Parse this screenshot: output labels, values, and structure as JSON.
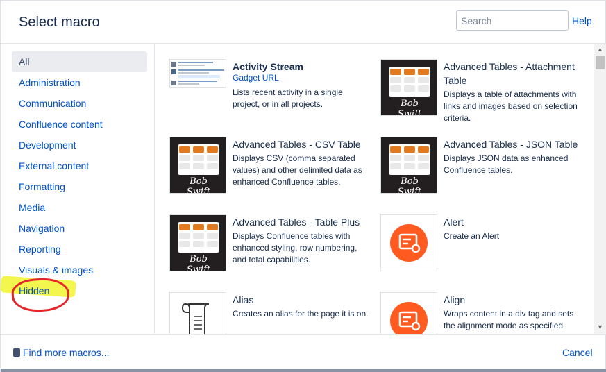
{
  "header": {
    "title": "Select macro",
    "search_placeholder": "Search",
    "help_label": "Help"
  },
  "sidebar": {
    "categories": [
      {
        "label": "All",
        "active": true
      },
      {
        "label": "Administration"
      },
      {
        "label": "Communication"
      },
      {
        "label": "Confluence content"
      },
      {
        "label": "Development"
      },
      {
        "label": "External content"
      },
      {
        "label": "Formatting"
      },
      {
        "label": "Media"
      },
      {
        "label": "Navigation"
      },
      {
        "label": "Reporting"
      },
      {
        "label": "Visuals & images"
      },
      {
        "label": "Hidden"
      }
    ]
  },
  "macros": [
    {
      "name": "Activity Stream",
      "link": "Gadget URL",
      "description": "Lists recent activity in a single project, or in all projects.",
      "thumb": "activity-stream"
    },
    {
      "name": "Advanced Tables - Attachment Table",
      "description": "Displays a table of attachments with links and images based on selection criteria.",
      "thumb": "bob-swift"
    },
    {
      "name": "Advanced Tables - CSV Table",
      "description": "Displays CSV (comma separated values) and other delimited data as enhanced Confluence tables.",
      "thumb": "bob-swift"
    },
    {
      "name": "Advanced Tables - JSON Table",
      "description": "Displays JSON data as enhanced Confluence tables.",
      "thumb": "bob-swift"
    },
    {
      "name": "Advanced Tables - Table Plus",
      "description": "Displays Confluence tables with enhanced styling, row numbering, and total capabilities.",
      "thumb": "bob-swift"
    },
    {
      "name": "Alert",
      "description": "Create an Alert",
      "thumb": "alert"
    },
    {
      "name": "Alias",
      "description": "Creates an alias for the page it is on.",
      "thumb": "scroll"
    },
    {
      "name": "Align",
      "description": "Wraps content in a div tag and sets the alignment mode as specified",
      "thumb": "alert"
    }
  ],
  "thumb_labels": {
    "bob_swift": "Bob Swift"
  },
  "footer": {
    "find_more_label": "Find more macros...",
    "cancel_label": "Cancel"
  },
  "colors": {
    "link": "#0052cc",
    "text": "#172b4d",
    "bob_swift_header": "#e07b22",
    "alert_orange": "#ff5a1f",
    "highlighter": "#f1f53a",
    "annotation_red": "#e4262c"
  },
  "icons": {
    "help": "help-link",
    "find_more": "marketplace-bag-icon",
    "scroll_up": "arrow-up-icon",
    "scroll_down": "arrow-down-icon"
  }
}
